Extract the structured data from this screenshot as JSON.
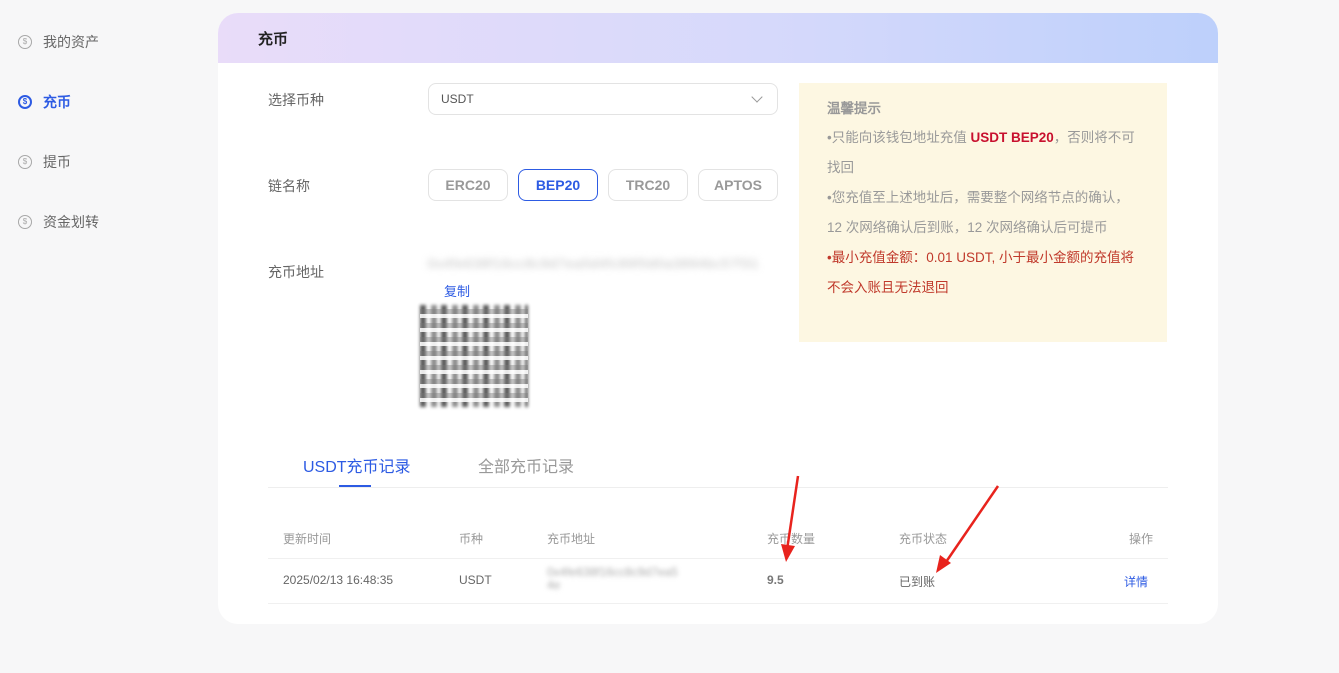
{
  "sidebar": {
    "items": [
      {
        "label": "我的资产",
        "icon": "dollar-circle-icon"
      },
      {
        "label": "充币",
        "icon": "deposit-icon"
      },
      {
        "label": "提币",
        "icon": "withdraw-icon"
      },
      {
        "label": "资金划转",
        "icon": "transfer-icon"
      }
    ],
    "active": "充币"
  },
  "page": {
    "title": "充币",
    "coin_label": "选择币种",
    "coin_value": "USDT",
    "chain_label": "链名称",
    "chains": [
      "ERC20",
      "BEP20",
      "TRC20",
      "APTOS"
    ],
    "active_chain": "BEP20",
    "address_label": "充币地址",
    "address_value": "0x4fe638f16cc8c9d7ea5d4fc89f0d0a3894bc57f31",
    "copy_label": "复制"
  },
  "tips": {
    "title": "温馨提示",
    "line1_prefix": "•只能向该钱包地址充值 ",
    "line1_highlight": "USDT BEP20",
    "line1_suffix": "，否则将不可找回",
    "line2": "•您充值至上述地址后，需要整个网络节点的确认，12 次网络确认后到账，12 次网络确认后可提币",
    "line3": "•最小充值金额：0.01 USDT, 小于最小金额的充值将不会入账且无法退回"
  },
  "records": {
    "tabs": [
      "USDT充币记录",
      "全部充币记录"
    ],
    "active_tab": "USDT充币记录",
    "columns": [
      "更新时间",
      "币种",
      "充币地址",
      "充币数量",
      "充币状态",
      "操作"
    ],
    "rows": [
      {
        "time": "2025/02/13 16:48:35",
        "coin": "USDT",
        "address_line1": "0x4fe638f16cc8c9d7ea5",
        "address_line2": "4e",
        "amount": "9.5",
        "status": "已到账",
        "action": "详情"
      }
    ]
  },
  "colors": {
    "accent": "#2d5be3",
    "annotation_arrow": "#e8231d",
    "tips_bg": "#fdf7e2"
  }
}
